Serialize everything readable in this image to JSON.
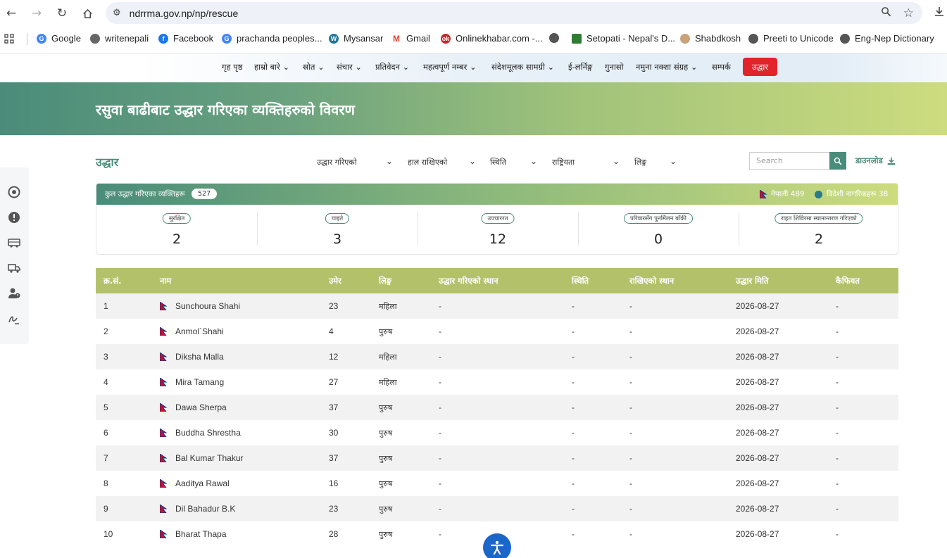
{
  "browser": {
    "url": "ndrrma.gov.np/np/rescue",
    "bookmarks": [
      "Google",
      "writenepali",
      "Facebook",
      "prachanda peoples...",
      "Mysansar",
      "Gmail",
      "Onlinekhabar.com -...",
      "",
      "Setopati - Nepal's D...",
      "Shabdkosh",
      "Preeti to Unicode",
      "Eng-Nep Dictionary"
    ]
  },
  "nav": {
    "items": [
      "गृह पृष्ठ",
      "हाम्रो बारे",
      "स्रोत",
      "संचार",
      "प्रतिवेदन",
      "महत्वपूर्ण नम्बर",
      "संदेशमूलक सामग्री",
      "ई-लर्निङ्ग",
      "गुनासो",
      "नमुना नक्शा संग्रह",
      "सम्पर्क"
    ],
    "rescue_label": "उद्धार"
  },
  "banner": {
    "title": "रसुवा बाढीबाट उद्धार गरिएका व्यक्तिहरुको विवरण"
  },
  "filters": {
    "section_title": "उद्धार",
    "items": [
      "उद्धार गरिएको",
      "हाल राखिएको",
      "स्थिति",
      "राष्ट्रियता",
      "लिङ्ग"
    ],
    "search_placeholder": "Search",
    "download_label": "डाउनलोड"
  },
  "summary": {
    "total_label": "कुल उद्धार गरिएका व्यक्तिहरू",
    "total_count": "527",
    "nepali_label": "नेपाली 489",
    "foreign_label": "विदेशी नागरिकहरू 38",
    "stats": [
      {
        "label": "सुरक्षित",
        "value": "2"
      },
      {
        "label": "घाइते",
        "value": "3"
      },
      {
        "label": "उपचाररत",
        "value": "12"
      },
      {
        "label": "परिवारसँग पुनर्मिलन बाँकी",
        "value": "0"
      },
      {
        "label": "राहत शिविरमा स्थानान्तरण गरिएको",
        "value": "2"
      }
    ]
  },
  "table": {
    "headers": [
      "क्र.सं.",
      "नाम",
      "उमेर",
      "लिङ्ग",
      "उद्धार गरिएको स्थान",
      "स्थिति",
      "राखिएको स्थान",
      "उद्धार मिति",
      "कैफियत"
    ],
    "rows": [
      {
        "sn": "1",
        "name": "Sunchoura Shahi",
        "age": "23",
        "gender": "महिला",
        "place": "-",
        "status": "-",
        "kept": "-",
        "date": "2026-08-27",
        "remarks": "-"
      },
      {
        "sn": "2",
        "name": "Anmol`Shahi",
        "age": "4",
        "gender": "पुरुष",
        "place": "-",
        "status": "-",
        "kept": "-",
        "date": "2026-08-27",
        "remarks": "-"
      },
      {
        "sn": "3",
        "name": "Diksha Malla",
        "age": "12",
        "gender": "महिला",
        "place": "-",
        "status": "-",
        "kept": "-",
        "date": "2026-08-27",
        "remarks": "-"
      },
      {
        "sn": "4",
        "name": "Mira Tamang",
        "age": "27",
        "gender": "महिला",
        "place": "-",
        "status": "-",
        "kept": "-",
        "date": "2026-08-27",
        "remarks": "-"
      },
      {
        "sn": "5",
        "name": "Dawa Sherpa",
        "age": "37",
        "gender": "पुरुष",
        "place": "-",
        "status": "-",
        "kept": "-",
        "date": "2026-08-27",
        "remarks": "-"
      },
      {
        "sn": "6",
        "name": "Buddha Shrestha",
        "age": "30",
        "gender": "पुरुष",
        "place": "-",
        "status": "-",
        "kept": "-",
        "date": "2026-08-27",
        "remarks": "-"
      },
      {
        "sn": "7",
        "name": "Bal Kumar Thakur",
        "age": "37",
        "gender": "पुरुष",
        "place": "-",
        "status": "-",
        "kept": "-",
        "date": "2026-08-27",
        "remarks": "-"
      },
      {
        "sn": "8",
        "name": "Aaditya Rawal",
        "age": "16",
        "gender": "पुरुष",
        "place": "-",
        "status": "-",
        "kept": "-",
        "date": "2026-08-27",
        "remarks": "-"
      },
      {
        "sn": "9",
        "name": "Dil Bahadur B.K",
        "age": "23",
        "gender": "पुरुष",
        "place": "-",
        "status": "-",
        "kept": "-",
        "date": "2026-08-27",
        "remarks": "-"
      },
      {
        "sn": "10",
        "name": "Bharat Thapa",
        "age": "28",
        "gender": "पुरुष",
        "place": "-",
        "status": "-",
        "kept": "-",
        "date": "2026-08-27",
        "remarks": "-"
      }
    ]
  },
  "colors": {
    "brand": "#4a8c7a",
    "header": "#b3c26a",
    "danger": "#e0242a",
    "accessibility": "#1a66c9"
  }
}
